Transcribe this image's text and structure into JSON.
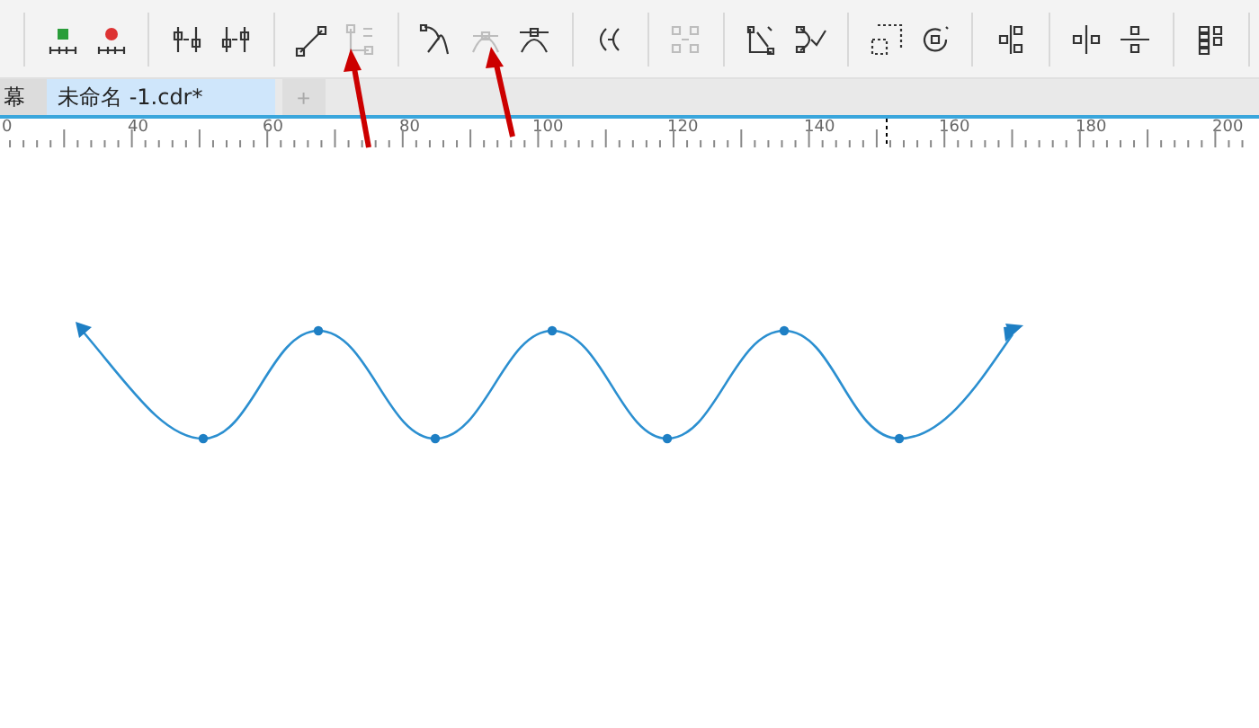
{
  "toolbar": {
    "groups": [
      [
        {
          "kind": "add-node",
          "disabled": false
        },
        {
          "kind": "delete-node",
          "disabled": false
        }
      ],
      [
        {
          "kind": "join-nodes",
          "disabled": false
        },
        {
          "kind": "break-curve",
          "disabled": false
        }
      ],
      [
        {
          "kind": "to-line",
          "disabled": false
        },
        {
          "kind": "to-curve",
          "disabled": true
        }
      ],
      [
        {
          "kind": "cusp",
          "disabled": false
        },
        {
          "kind": "smooth",
          "disabled": true
        },
        {
          "kind": "symmetrical",
          "disabled": false
        }
      ],
      [
        {
          "kind": "reverse",
          "disabled": false
        }
      ],
      [
        {
          "kind": "extract",
          "disabled": true
        }
      ],
      [
        {
          "kind": "extend",
          "disabled": false
        },
        {
          "kind": "auto-close",
          "disabled": false
        }
      ],
      [
        {
          "kind": "stretch",
          "disabled": false
        },
        {
          "kind": "rotate",
          "disabled": false
        }
      ],
      [
        {
          "kind": "align",
          "disabled": false
        }
      ],
      [
        {
          "kind": "align-h",
          "disabled": false
        },
        {
          "kind": "align-v",
          "disabled": false
        }
      ],
      [
        {
          "kind": "distribute",
          "disabled": false
        }
      ]
    ]
  },
  "tabs": [
    {
      "label": "幕",
      "selected": false
    },
    {
      "label": "未命名 -1.cdr*",
      "selected": true
    }
  ],
  "new_tab_button": "+",
  "ruler": {
    "labels": [
      "0",
      "40",
      "60",
      "80",
      "100",
      "120",
      "140",
      "160",
      "180",
      "200"
    ]
  }
}
